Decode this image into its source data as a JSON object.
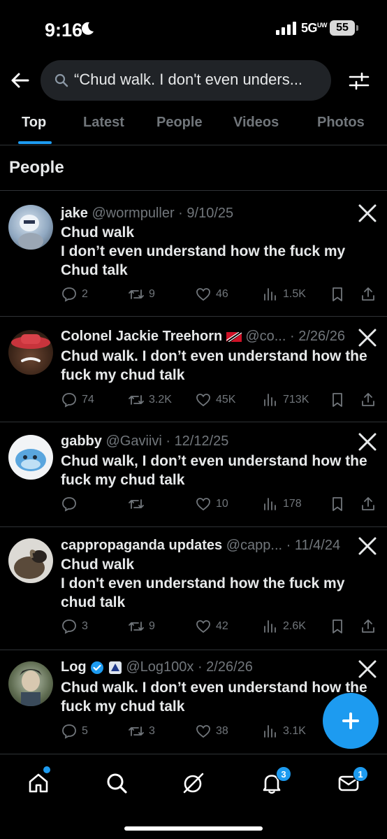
{
  "status": {
    "time": "9:16",
    "network": "5G",
    "network_sup": "UW",
    "battery": "55"
  },
  "search": {
    "query": "“Chud walk. I don't even unders..."
  },
  "tabs": [
    "Top",
    "Latest",
    "People",
    "Videos",
    "Photos"
  ],
  "section": {
    "title": "People"
  },
  "tweets": [
    {
      "name": "jake",
      "handle": "@wormpuller",
      "date": "9/10/25",
      "lines": [
        "Chud walk",
        "I don’t even understand how the fuck my",
        "Chud talk"
      ],
      "replies": "2",
      "reposts": "9",
      "likes": "46",
      "views": "1.5K"
    },
    {
      "name": "Colonel Jackie Treehorn",
      "handle": "@co...",
      "date": "2/26/26",
      "lines": [
        "Chud walk. I don’t even understand how the",
        "fuck my chud talk"
      ],
      "replies": "74",
      "reposts": "3.2K",
      "likes": "45K",
      "views": "713K"
    },
    {
      "name": "gabby",
      "handle": "@Gaviivi",
      "date": "12/12/25",
      "lines": [
        "Chud walk, I don’t even understand how the",
        "fuck my chud talk"
      ],
      "replies": "",
      "reposts": "",
      "likes": "10",
      "views": "178"
    },
    {
      "name": "cappropaganda updates",
      "handle": "@capp...",
      "date": "11/4/24",
      "lines": [
        "Chud walk",
        "I don't even understand how the fuck my",
        "chud talk"
      ],
      "replies": "3",
      "reposts": "9",
      "likes": "42",
      "views": "2.6K"
    },
    {
      "name": "Log",
      "handle": "@Log100x",
      "date": "2/26/26",
      "lines": [
        "Chud walk. I don’t even understand how the",
        "fuck my chud talk"
      ],
      "replies": "5",
      "reposts": "3",
      "likes": "38",
      "views": "3.1K"
    }
  ],
  "nav": {
    "notifications_badge": "3",
    "messages_badge": "1"
  },
  "colors": {
    "accent": "#1d9bf0",
    "background": "#000000",
    "muted": "#71767b"
  }
}
